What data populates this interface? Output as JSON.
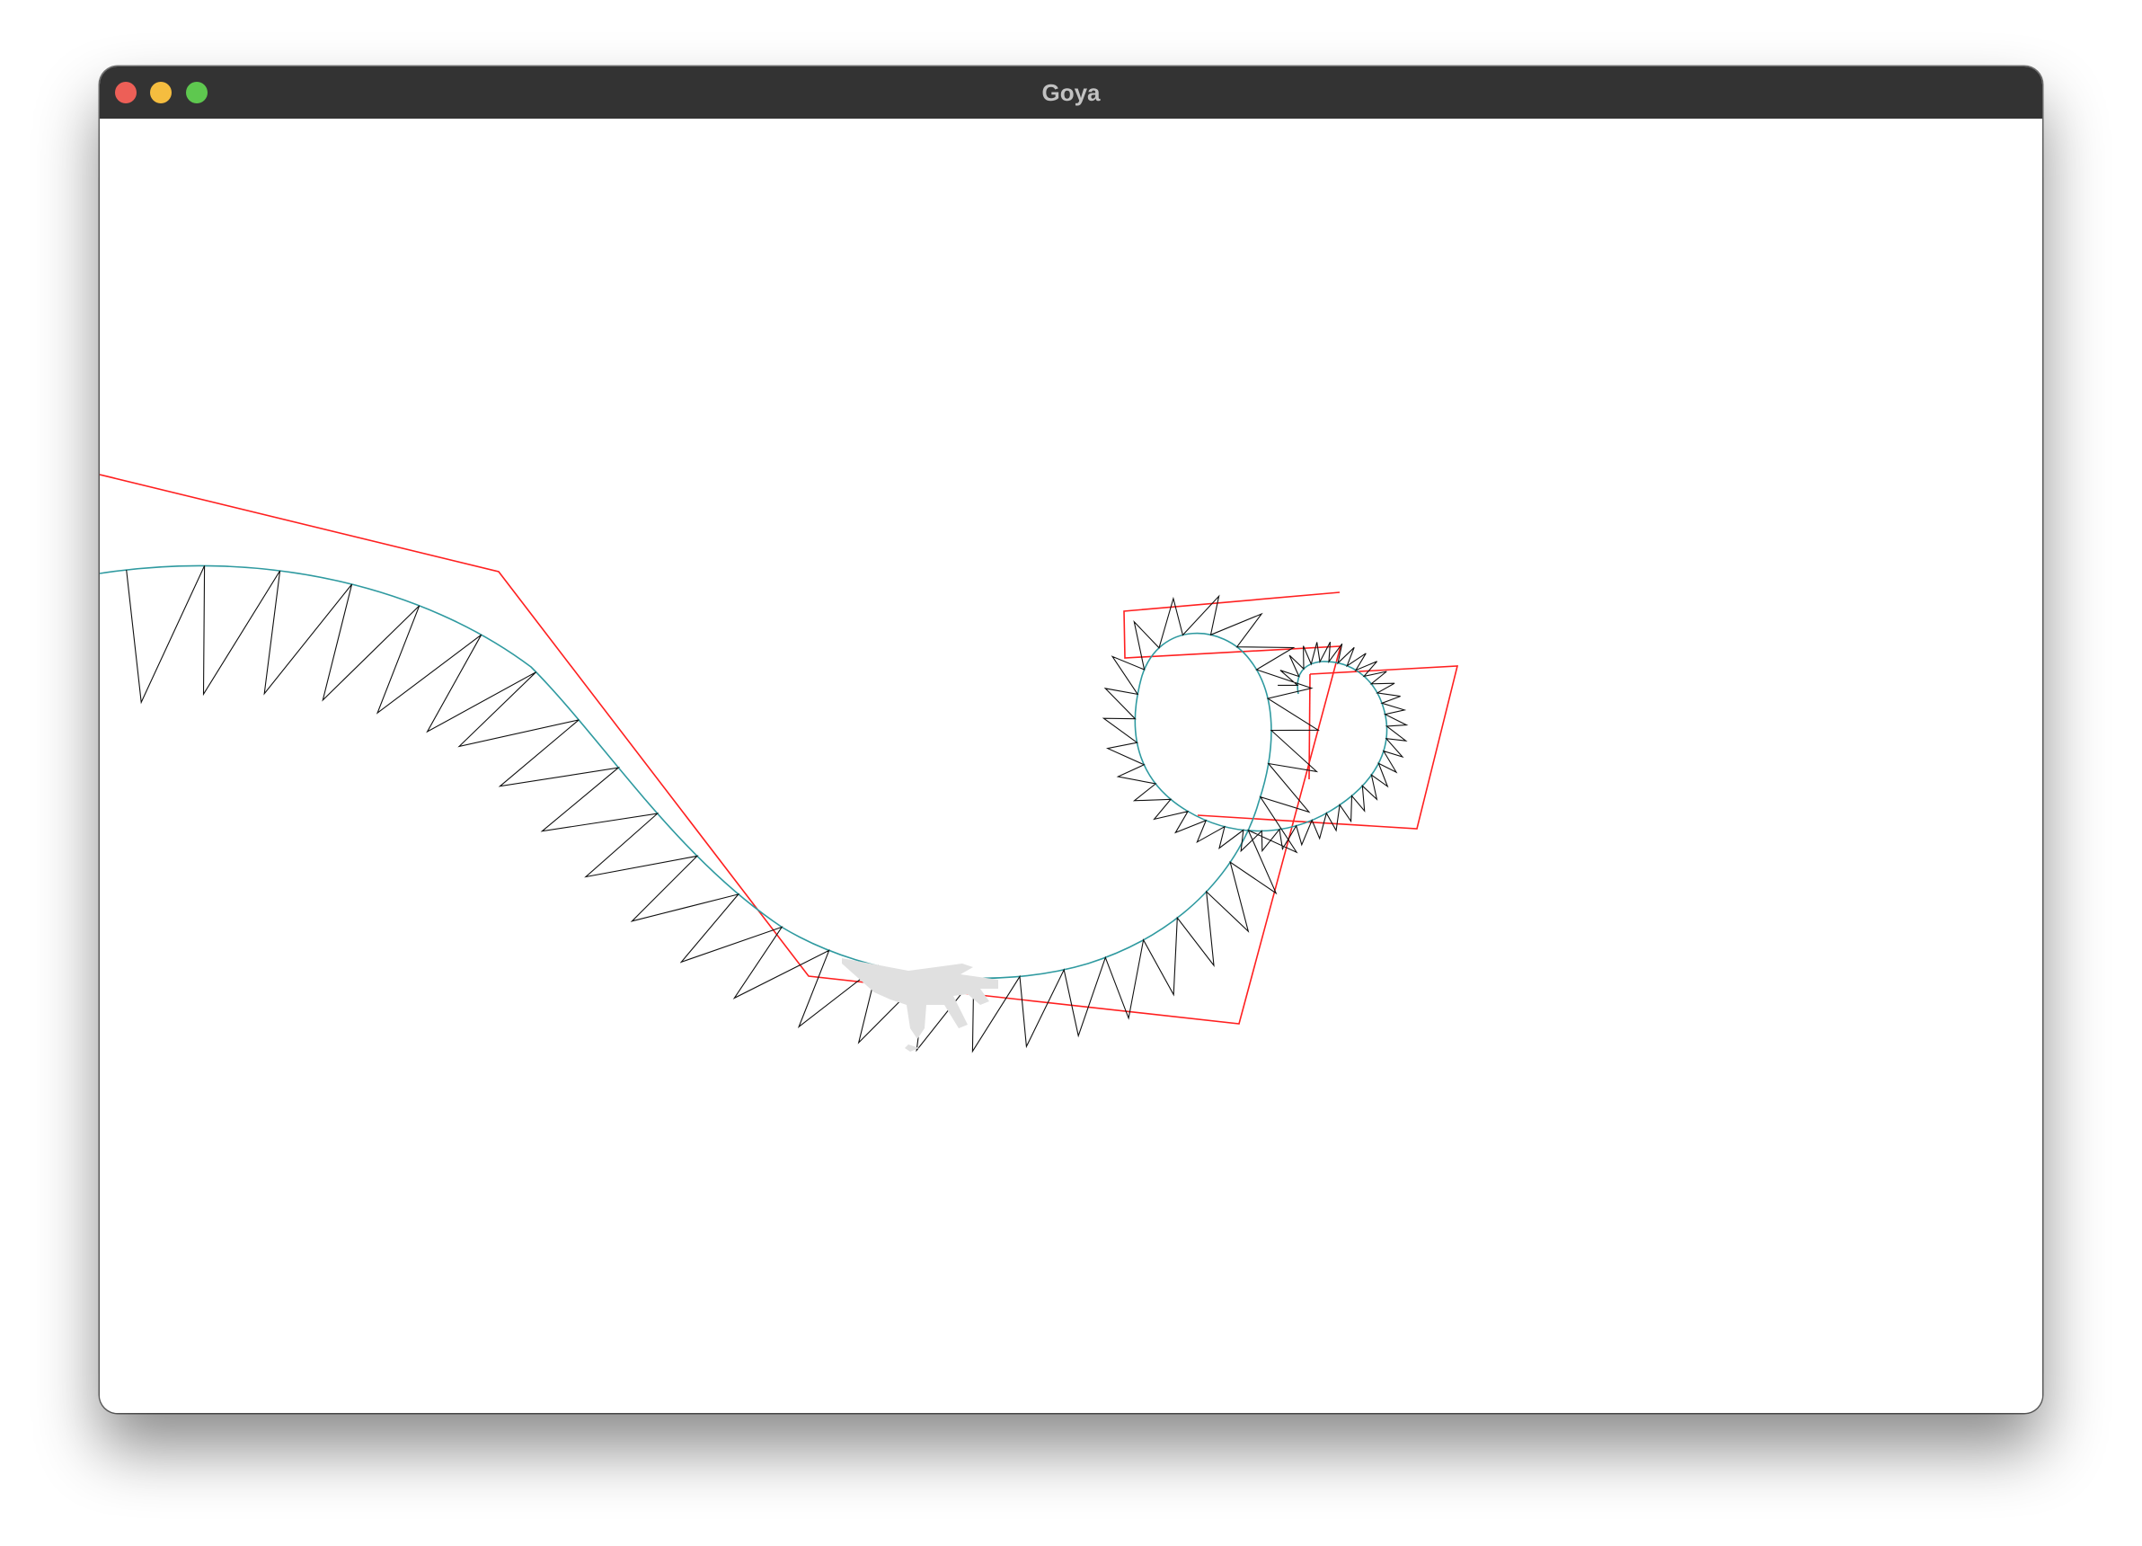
{
  "window": {
    "title": "Goya",
    "buttons": {
      "close": "close",
      "minimize": "minimize",
      "zoom": "zoom"
    }
  },
  "canvas": {
    "colors": {
      "background": "#ffffff",
      "control_polygon": "#ff2020",
      "curve": "#2f9aa0",
      "strokes": "#111111",
      "aircraft": "#e0e0e0"
    },
    "icons": {
      "aircraft": "fighter-jet-silhouette"
    }
  }
}
